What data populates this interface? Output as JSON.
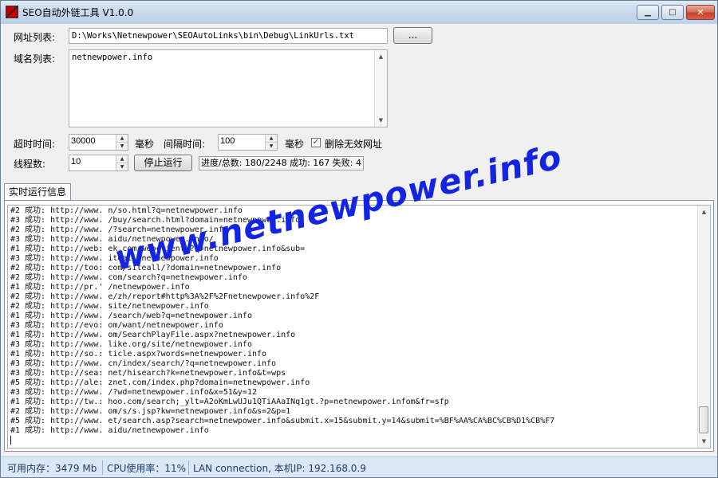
{
  "window": {
    "title": "SEO自动外链工具 V1.0.0",
    "controls": {
      "minimize": "▁",
      "maximize": "□",
      "close": "✕"
    }
  },
  "form": {
    "url_list_label": "网址列表:",
    "url_list_value": "D:\\Works\\Netnewpower\\SEOAutoLinks\\bin\\Debug\\LinkUrls.txt",
    "browse_button": "...",
    "domain_list_label": "域名列表:",
    "domain_list_value": "netnewpower.info",
    "timeout_label": "超时时间:",
    "timeout_value": "30000",
    "ms_unit_1": "毫秒",
    "interval_label": "间隔时间:",
    "interval_value": "100",
    "ms_unit_2": "毫秒",
    "delete_invalid_checked": true,
    "delete_invalid_label": "删除无效网址",
    "threads_label": "线程数:",
    "threads_value": "10",
    "stop_button": "停止运行",
    "progress_text": "进度/总数: 180/2248 成功: 167 失败: 4"
  },
  "tabs": [
    {
      "label": "实时运行信息",
      "active": true
    }
  ],
  "log": {
    "lines": [
      "#2 成功: http://www.        n/so.html?q=netnewpower.info",
      "#3 成功: http://www.        /buy/search.html?domain=netnewpower.info",
      "#2 成功: http://www.        /?search=netnewpower.info",
      "#3 成功: http://www.        aidu/netnewpower.info/",
      "#1 成功: http://web:        ek.com/webclient/?q=netnewpower.info&sub=",
      "#3 成功: http://www.        iteall/netnewpower.info",
      "#2 成功: http://too:         com/siteall/?domain=netnewpower.info",
      "#2 成功: http://www.         com/search?q=netnewpower.info",
      "#1 成功: http://pr.'        /netnewpower.info",
      "#2 成功: http://www.        e/zh/report#http%3A%2F%2Fnetnewpower.info%2F",
      "#2 成功: http://www.        site/netnewpower.info",
      "#1 成功: http://www.        /search/web?q=netnewpower.info",
      "#3 成功: http://evo:        om/want/netnewpower.info",
      "#1 成功: http://www.        om/SearchPlayFile.aspx?netnewpower.info",
      "#3 成功: http://www.        like.org/site/netnewpower.info",
      "#1 成功: http://so.:        ticle.aspx?words=netnewpower.info",
      "#3 成功: http://www.         cn/index/search/?q=netnewpower.info",
      "#3 成功: http://sea:         net/hisearch?k=netnewpower.info&t=wps",
      "#5 成功: http://ale:        znet.com/index.php?domain=netnewpower.info",
      "#3 成功: http://www.        /?wd=netnewpower.info&x=51&y=12",
      "#1 成功: http://tw.:        hoo.com/search;_ylt=A2oKmLwUJu1QTiAAaINq1gt.?p=netnewpower.infom&fr=sfp",
      "#2 成功: http://www.        om/s/s.jsp?kw=netnewpower.info&s=2&p=1",
      "#5 成功: http://www.        et/search.asp?search=netnewpower.info&submit.x=15&submit.y=14&submit=%BF%AA%CA%BC%CB%D1%CB%F7",
      "#1 成功: http://www.        aidu/netnewpower.info"
    ]
  },
  "watermark": "www.netnewpower.info",
  "statusbar": {
    "memory": "可用内存：3479 Mb",
    "cpu": "CPU使用率：11%",
    "network": "LAN connection,  本机IP: 192.168.0.9"
  },
  "colors": {
    "watermark": "#1325e0",
    "statusbar_text": "#1e3a66"
  },
  "icons": [
    "app-icon",
    "minimize-icon",
    "maximize-icon",
    "close-icon",
    "checkmark-icon",
    "scroll-up-icon",
    "scroll-down-icon"
  ]
}
